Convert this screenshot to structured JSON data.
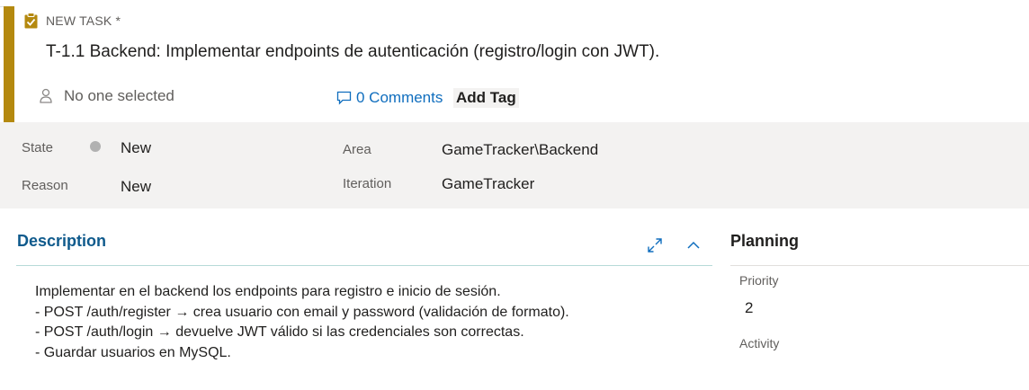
{
  "header": {
    "type_label": "NEW TASK *",
    "title": "T-1.1 Backend: Implementar endpoints de autenticación (registro/login con JWT).",
    "assigned": "No one selected",
    "comments": "0 Comments",
    "add_tag": "Add Tag",
    "accent_color": "#b4890f"
  },
  "fields": {
    "state_label": "State",
    "state_value": "New",
    "state_color": "#b1b1b1",
    "reason_label": "Reason",
    "reason_value": "New",
    "area_label": "Area",
    "area_value": "GameTracker\\Backend",
    "iteration_label": "Iteration",
    "iteration_value": "GameTracker"
  },
  "description": {
    "title": "Description",
    "lines": [
      "Implementar en el backend los endpoints para registro e inicio de sesión.",
      "- POST /auth/register → crea usuario con email y password (validación de formato).",
      "- POST /auth/login → devuelve JWT válido si las credenciales son correctas.",
      "- Guardar usuarios en MySQL."
    ]
  },
  "planning": {
    "title": "Planning",
    "priority_label": "Priority",
    "priority_value": "2",
    "activity_label": "Activity"
  },
  "icons": {
    "task": "clipboard-check-icon",
    "person": "person-icon",
    "comment": "comment-icon",
    "expand": "expand-icon",
    "collapse": "chevron-up-icon"
  }
}
